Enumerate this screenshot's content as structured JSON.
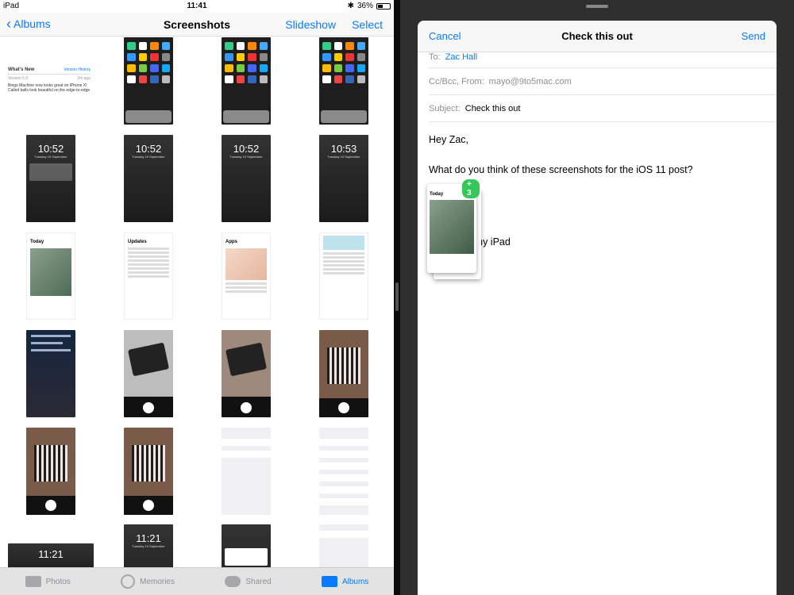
{
  "status_bar": {
    "device": "iPad",
    "time": "11:41",
    "battery": "36%"
  },
  "photos": {
    "nav": {
      "back_label": "Albums",
      "title": "Screenshots",
      "slideshow_label": "Slideshow",
      "select_label": "Select"
    },
    "whats_new": {
      "title": "What's New",
      "link": "Version History",
      "version": "Version 5.9",
      "ago": "2m ago",
      "line1": "Bingo Machine now looks great on iPhone X!",
      "line2": "Called balls look beautiful on the edge-to-edge"
    },
    "lock_times": [
      "10:52",
      "10:52",
      "10:52",
      "10:53"
    ],
    "lock_date": "Tuesday 19 September",
    "updates_title": "Updates",
    "apps_title": "Apps",
    "today_title": "Today",
    "bottom_times": [
      "11:21",
      "11:21"
    ],
    "tabs": [
      {
        "label": "Photos"
      },
      {
        "label": "Memories"
      },
      {
        "label": "Shared"
      },
      {
        "label": "Albums"
      }
    ]
  },
  "mail": {
    "header": {
      "cancel_label": "Cancel",
      "title": "Check this out",
      "send_label": "Send"
    },
    "to_label": "To:",
    "to_value": "Zac Hall",
    "ccbcc_label": "Cc/Bcc, From:",
    "from_value": "mayo@9to5mac.com",
    "subject_label": "Subject:",
    "subject_value": "Check this out",
    "body": {
      "greeting": "Hey Zac,",
      "line1": "What do you think of these screenshots for the iOS 11 post?",
      "signature": "Sent from my iPad"
    },
    "drag_badge": "+ 3",
    "drag_card_title": "Today"
  }
}
